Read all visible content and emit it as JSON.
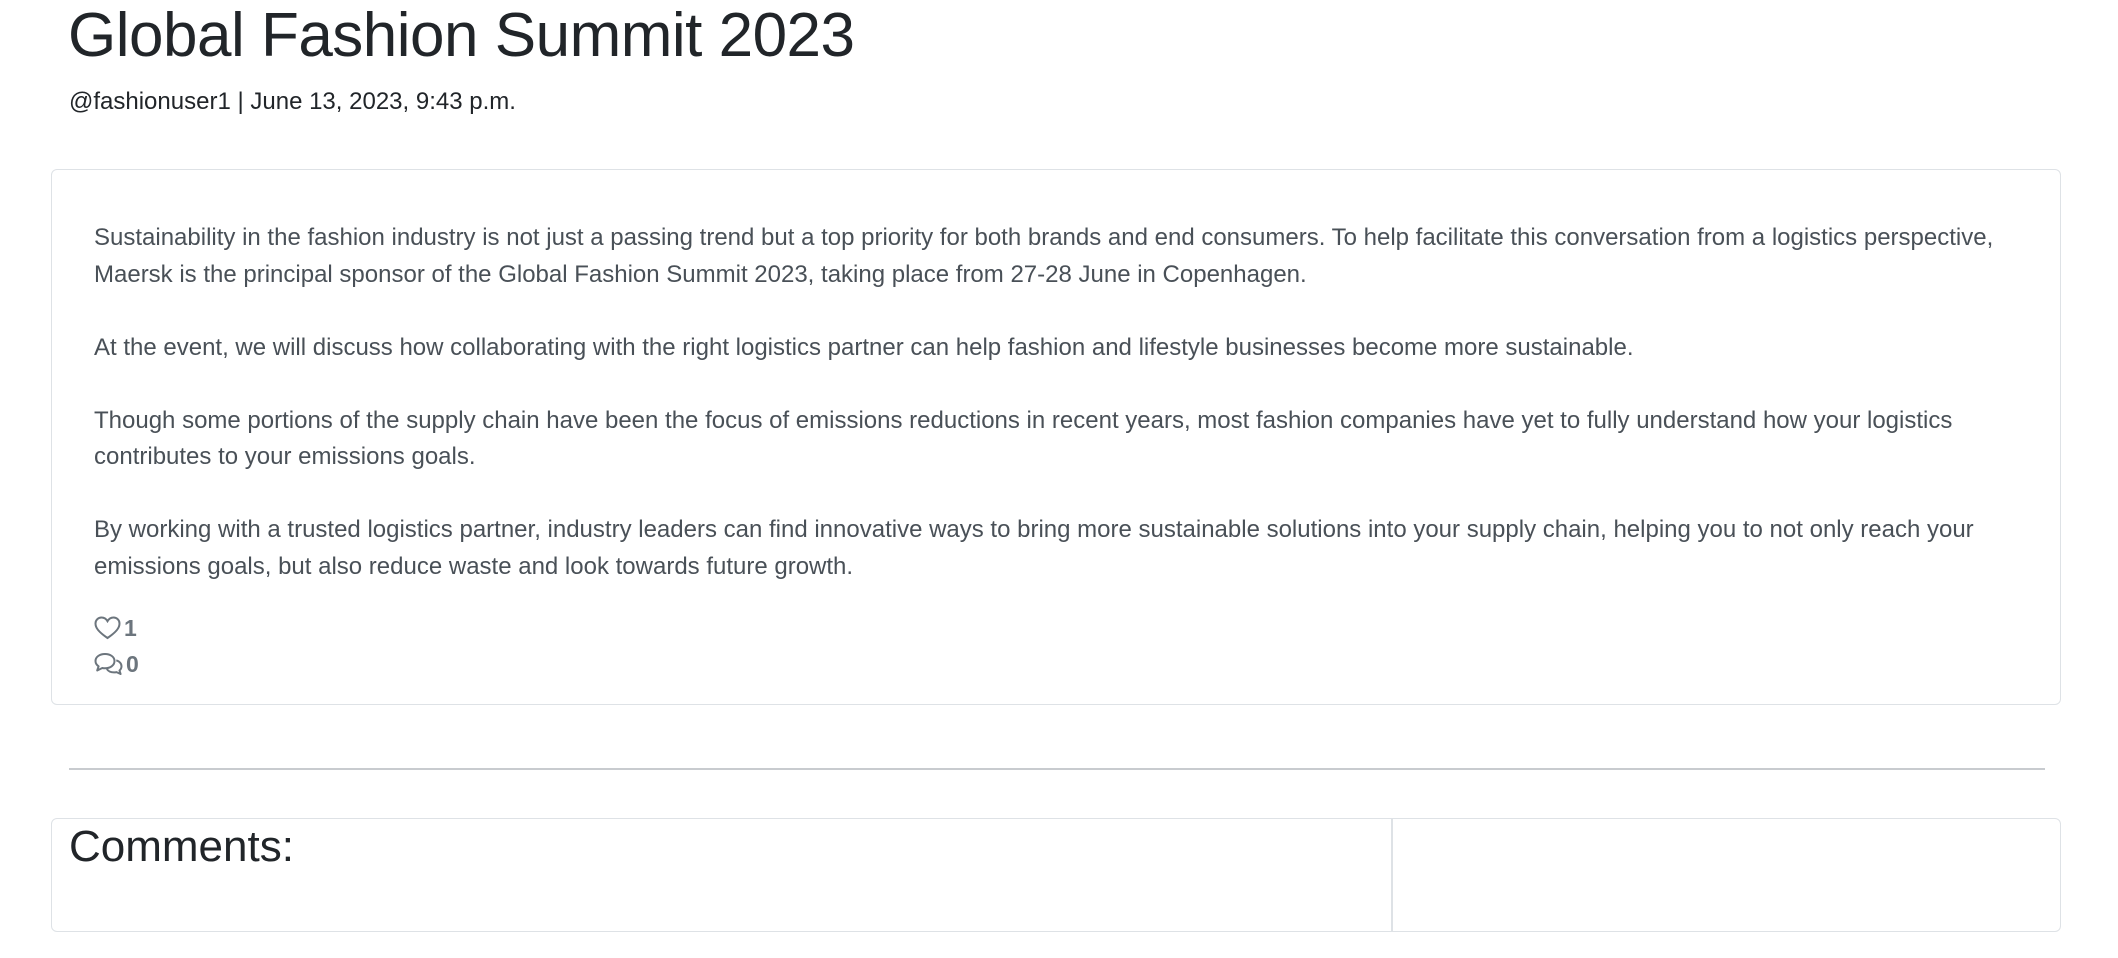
{
  "post": {
    "title": "Global Fashion Summit 2023",
    "author": "@fashionuser1",
    "separator": " | ",
    "timestamp": "June 13, 2023, 9:43 p.m.",
    "paragraphs": [
      "Sustainability in the fashion industry is not just a passing trend but a top priority for both brands and end consumers. To help facilitate this conversation from a logistics perspective, Maersk is the principal sponsor of the Global Fashion Summit 2023, taking place from 27-28 June in Copenhagen.",
      "At the event, we will discuss how collaborating with the right logistics partner can help fashion and lifestyle businesses become more sustainable.",
      "Though some portions of the supply chain have been the focus of emissions reductions in recent years, most fashion companies have yet to fully understand how your logistics contributes to your emissions goals.",
      "By working with a trusted logistics partner, industry leaders can find innovative ways to bring more sustainable solutions into your supply chain, helping you to not only reach your emissions goals, but also reduce waste and look towards future growth."
    ],
    "likes": {
      "icon": "heart-outline-icon",
      "count": "1"
    },
    "comments": {
      "icon": "chat-bubbles-icon",
      "count": "0"
    }
  },
  "comments_section": {
    "heading": "Comments:"
  },
  "colors": {
    "heading": "#212529",
    "body_text": "#495057",
    "muted": "#6c757d",
    "border": "#dee2e6"
  }
}
